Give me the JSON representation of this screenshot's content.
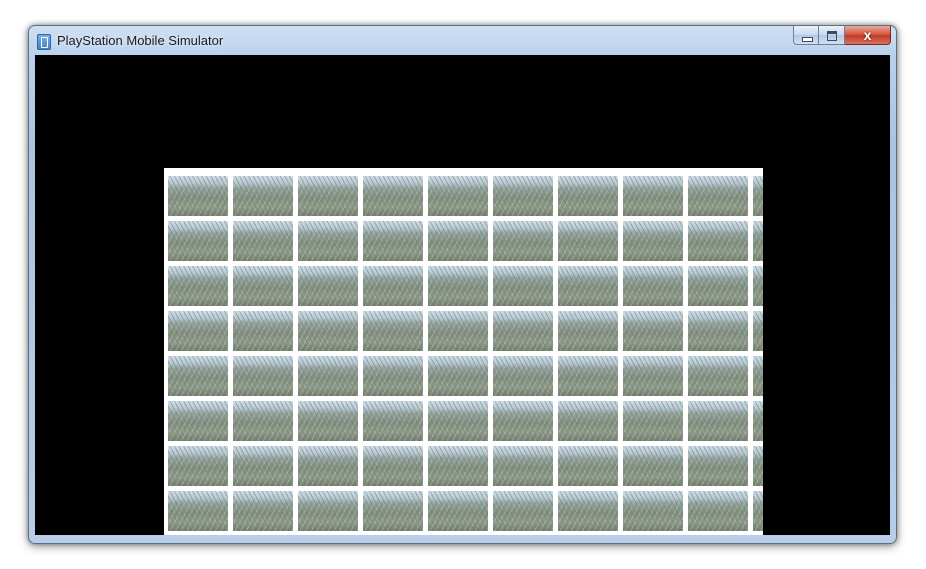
{
  "window": {
    "title": "PlayStation Mobile Simulator",
    "icon": "app-icon",
    "controls": {
      "minimize": "minimize-icon",
      "maximize": "maximize-icon",
      "close": "close-icon",
      "close_glyph": "x"
    }
  },
  "canvas": {
    "description_icon": "photo-thumbnail",
    "tile_rows": 8,
    "tile_columns": 10,
    "colors": {
      "background": "#000000",
      "render_surface": "#ffffff",
      "title_bar": "#b9d1ec",
      "close_button": "#c23b26"
    }
  }
}
